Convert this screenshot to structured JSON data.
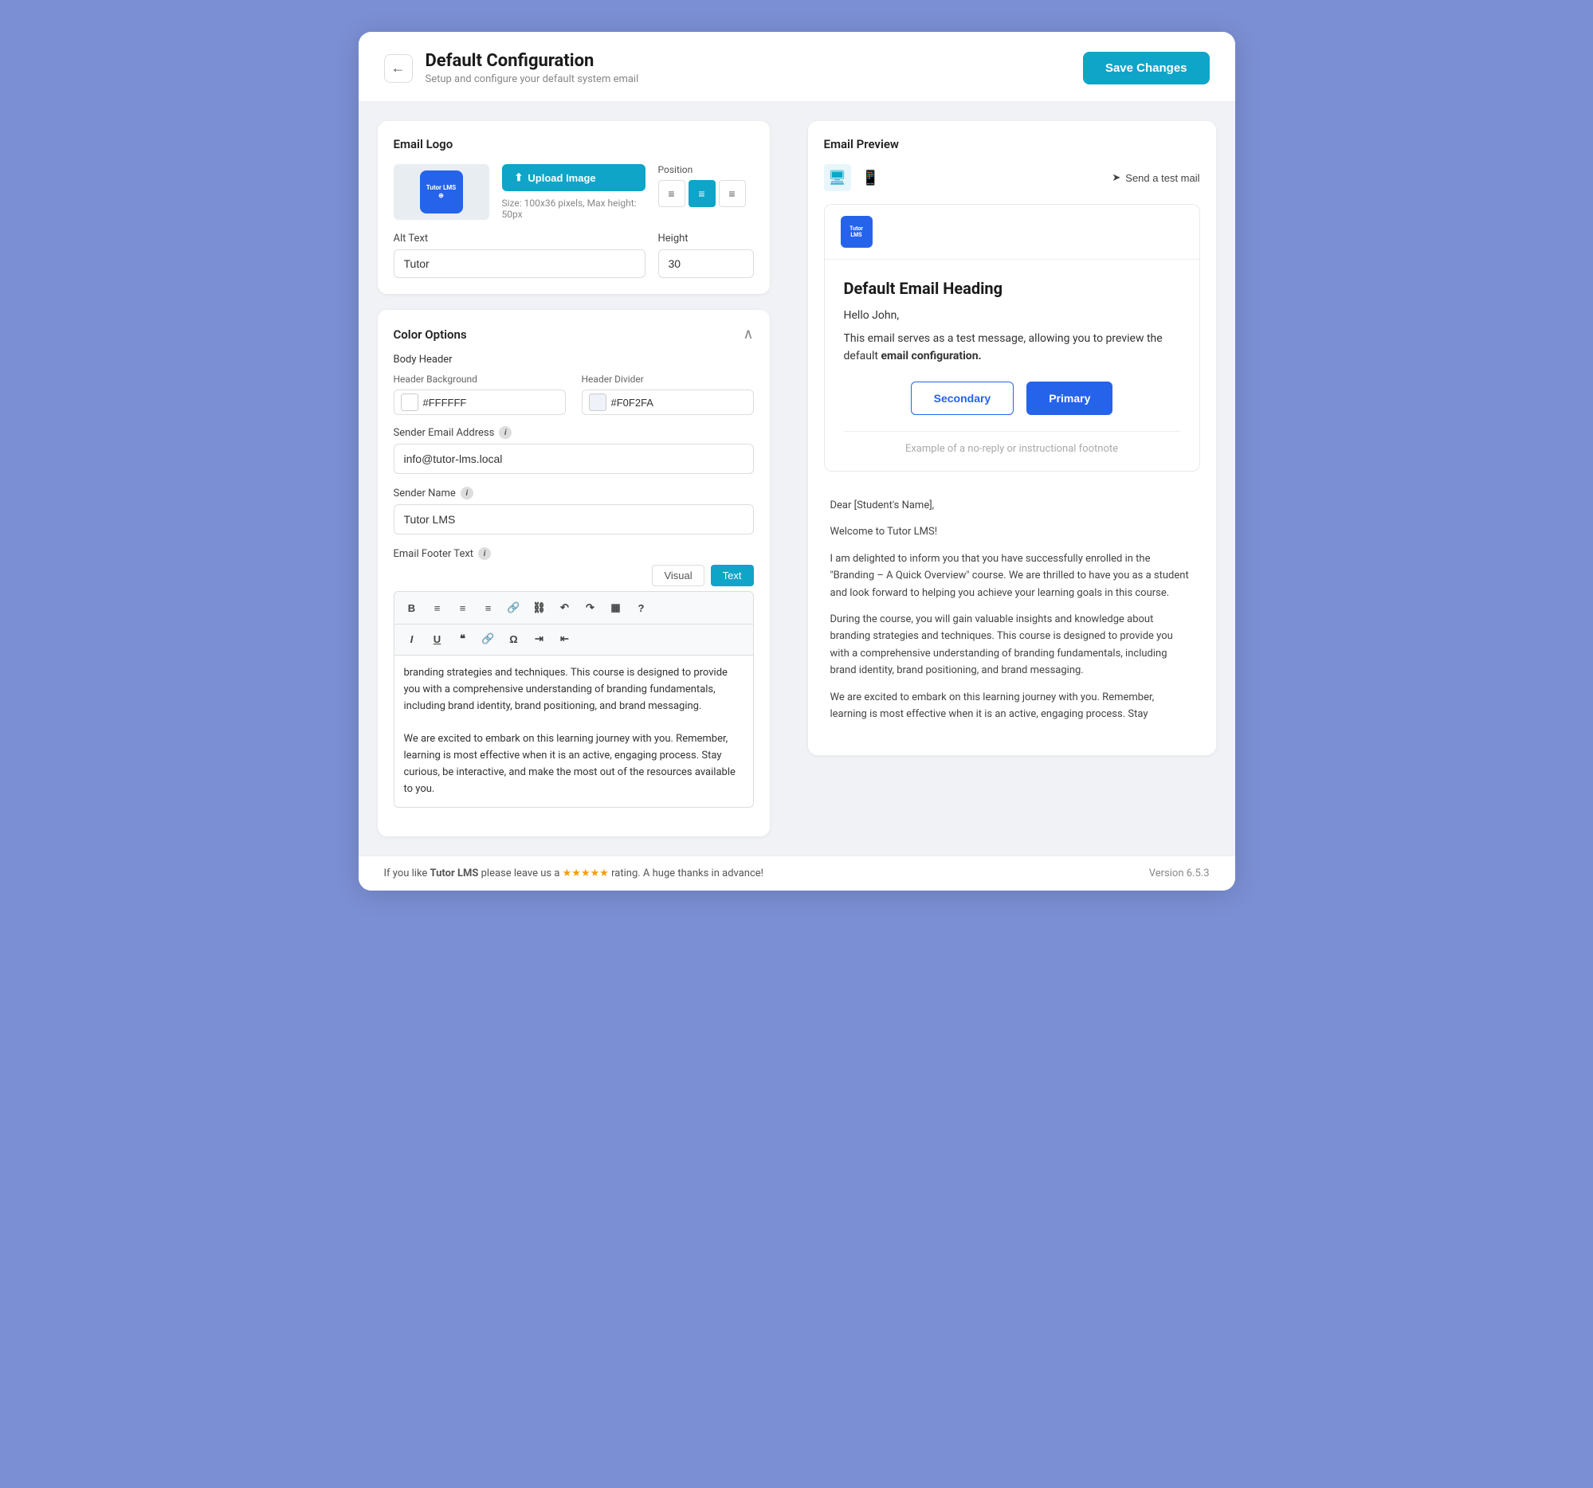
{
  "header": {
    "title": "Default Configuration",
    "subtitle": "Setup and configure your default system email",
    "save_label": "Save Changes",
    "back_label": "←"
  },
  "logo_section": {
    "title": "Email Logo",
    "upload_label": "Upload Image",
    "upload_size_info": "Size: 100x36 pixels, Max height: 50px",
    "position_label": "Position",
    "alt_text_label": "Alt Text",
    "alt_text_value": "Tutor",
    "height_label": "Height",
    "height_value": "30",
    "logo_text_line1": "Tutor LMS",
    "logo_text_line2": "⊕"
  },
  "color_options": {
    "title": "Color Options",
    "body_header_label": "Body Header",
    "header_background_label": "Header Background",
    "header_background_value": "#FFFFFF",
    "header_divider_label": "Header Divider",
    "header_divider_value": "#F0F2FA"
  },
  "sender": {
    "email_label": "Sender Email Address",
    "email_value": "info@tutor-lms.local",
    "name_label": "Sender Name",
    "name_value": "Tutor LMS",
    "footer_label": "Email Footer Text"
  },
  "editor_tabs": {
    "visual_label": "Visual",
    "text_label": "Text"
  },
  "editor_content": {
    "line1": "branding strategies and techniques. This course is designed to provide you with a comprehensive understanding of branding fundamentals, including brand identity, brand positioning, and brand messaging.",
    "line2": "We are excited to embark on this learning journey with you. Remember, learning is most effective when it is an active, engaging process. Stay curious, be interactive, and make the most out of the resources available to you."
  },
  "preview": {
    "title": "Email Preview",
    "send_test_label": "Send a test mail",
    "email_heading": "Default Email Heading",
    "greeting": "Hello John,",
    "body_text": "This email serves as a test message, allowing you to preview the default email configuration.",
    "secondary_btn": "Secondary",
    "primary_btn": "Primary",
    "footnote": "Example of a no-reply or instructional footnote",
    "full_preview_salutation": "Dear [Student's Name],",
    "full_preview_welcome": "Welcome to Tutor LMS!",
    "full_preview_line1": "I am delighted to inform you that you have successfully enrolled in the \"Branding – A Quick Overview\" course. We are thrilled to have you as a student and look forward to helping you achieve your learning goals in this course.",
    "full_preview_line2": "During the course, you will gain valuable insights and knowledge about branding strategies and techniques. This course is designed to provide you with a comprehensive understanding of branding fundamentals, including brand identity, brand positioning, and brand messaging.",
    "full_preview_line3": "We are excited to embark on this learning journey with you. Remember, learning is most effective when it is an active, engaging process. Stay"
  },
  "bottom_bar": {
    "left_text_before": "If you like ",
    "brand_name": "Tutor LMS",
    "left_text_after": " please leave us a ",
    "stars": "★★★★★",
    "left_text_end": " rating. A huge thanks in advance!",
    "version": "Version 6.5.3"
  }
}
